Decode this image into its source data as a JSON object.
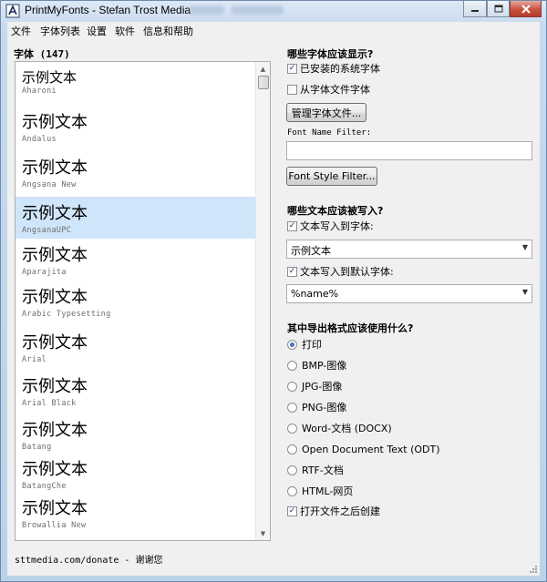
{
  "window": {
    "title": "PrintMyFonts - Stefan Trost Media"
  },
  "menu": [
    "文件",
    "字体列表",
    "设置",
    "软件",
    "信息和帮助"
  ],
  "font_list": {
    "heading": "字体 (147)",
    "items": [
      {
        "sample": "示例文本",
        "name": "Aharoni"
      },
      {
        "sample": "示例文本",
        "name": "Andalus"
      },
      {
        "sample": "示例文本",
        "name": "Angsana New"
      },
      {
        "sample": "示例文本",
        "name": "AngsanaUPC",
        "selected": true
      },
      {
        "sample": "示例文本",
        "name": "Aparajita"
      },
      {
        "sample": "示例文本",
        "name": "Arabic Typesetting"
      },
      {
        "sample": "示例文本",
        "name": "Arial"
      },
      {
        "sample": "示例文本",
        "name": "Arial Black"
      },
      {
        "sample": "示例文本",
        "name": "Batang"
      },
      {
        "sample": "示例文本",
        "name": "BatangChe"
      },
      {
        "sample": "示例文本",
        "name": "Browallia New"
      }
    ]
  },
  "footer": {
    "text": "sttmedia.com/donate - 谢谢您"
  },
  "display_section": {
    "title": "哪些字体应该显示?",
    "installed": {
      "label": "已安装的系统字体",
      "checked": true
    },
    "from_file": {
      "label": "从字体文件字体",
      "checked": false
    },
    "manage_button": "管理字体文件...",
    "name_filter_label": "Font Name Filter:",
    "name_filter_value": "",
    "style_filter_button": "Font Style Filter..."
  },
  "text_section": {
    "title": "哪些文本应该被写入?",
    "write_text": {
      "label": "文本写入到字体:",
      "checked": true
    },
    "text_value": "示例文本",
    "write_default": {
      "label": "文本写入到默认字体:",
      "checked": true
    },
    "default_value": "%name%"
  },
  "export_section": {
    "title": "其中导出格式应该使用什么?",
    "options": [
      {
        "label": "打印",
        "selected": true
      },
      {
        "label": "BMP-图像",
        "selected": false
      },
      {
        "label": "JPG-图像",
        "selected": false
      },
      {
        "label": "PNG-图像",
        "selected": false
      },
      {
        "label": "Word-文档 (DOCX)",
        "selected": false
      },
      {
        "label": "Open Document Text (ODT)",
        "selected": false
      },
      {
        "label": "RTF-文档",
        "selected": false
      },
      {
        "label": "HTML-网页",
        "selected": false
      }
    ],
    "open_after": {
      "label": "打开文件之后创建",
      "checked": true
    }
  },
  "icons": {
    "app": "font-app-icon",
    "minimize": "minimize-icon",
    "maximize": "maximize-icon",
    "close": "close-icon",
    "checkmark": "✓",
    "dropdown": "▼",
    "scroll_up": "▲",
    "scroll_down": "▼"
  },
  "colors": {
    "selection": "#cfe5fa",
    "close_button": "#c9523f",
    "window_frame": "#bcd2ea"
  }
}
